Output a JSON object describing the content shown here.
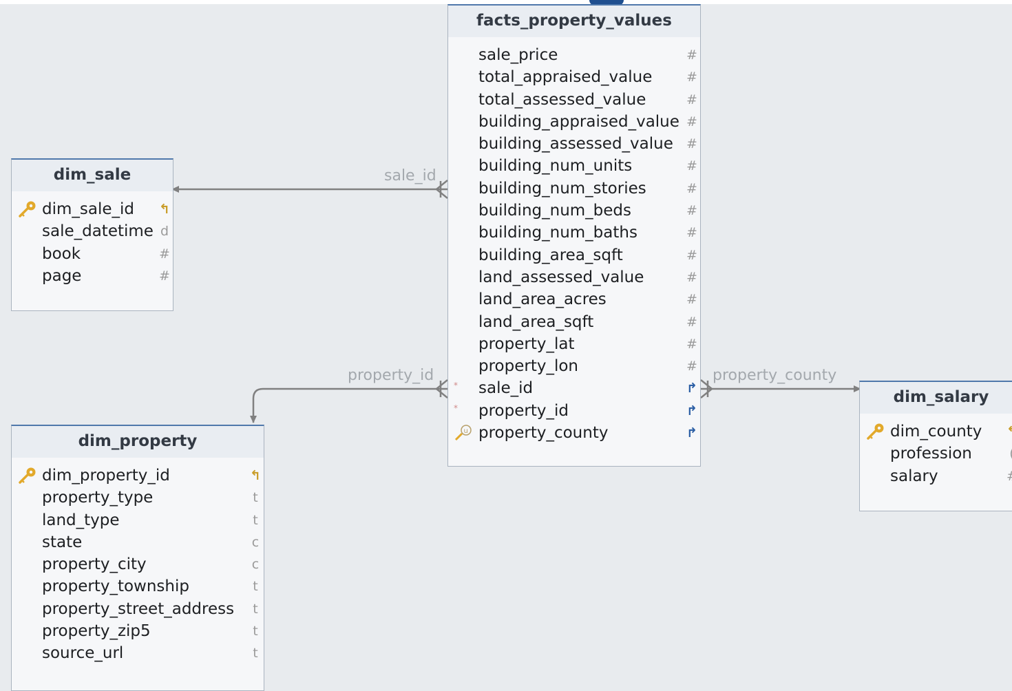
{
  "entities": {
    "facts": {
      "title": "facts_property_values",
      "fields": [
        {
          "name": "sale_price",
          "type": "#"
        },
        {
          "name": "total_appraised_value",
          "type": "#"
        },
        {
          "name": "total_assessed_value",
          "type": "#"
        },
        {
          "name": "building_appraised_value",
          "type": "#"
        },
        {
          "name": "building_assessed_value",
          "type": "#"
        },
        {
          "name": "building_num_units",
          "type": "#"
        },
        {
          "name": "building_num_stories",
          "type": "#"
        },
        {
          "name": "building_num_beds",
          "type": "#"
        },
        {
          "name": "building_num_baths",
          "type": "#"
        },
        {
          "name": "building_area_sqft",
          "type": "#"
        },
        {
          "name": "land_assessed_value",
          "type": "#"
        },
        {
          "name": "land_area_acres",
          "type": "#"
        },
        {
          "name": "land_area_sqft",
          "type": "#"
        },
        {
          "name": "property_lat",
          "type": "#"
        },
        {
          "name": "property_lon",
          "type": "#"
        },
        {
          "name": "sale_id",
          "type": "↱"
        },
        {
          "name": "property_id",
          "type": "↱"
        },
        {
          "name": "property_county",
          "type": "↱"
        }
      ]
    },
    "dim_sale": {
      "title": "dim_sale",
      "fields": [
        {
          "name": "dim_sale_id",
          "type": "↰"
        },
        {
          "name": "sale_datetime",
          "type": "d"
        },
        {
          "name": "book",
          "type": "#"
        },
        {
          "name": "page",
          "type": "#"
        }
      ]
    },
    "dim_property": {
      "title": "dim_property",
      "fields": [
        {
          "name": "dim_property_id",
          "type": "↰"
        },
        {
          "name": "property_type",
          "type": "t"
        },
        {
          "name": "land_type",
          "type": "t"
        },
        {
          "name": "state",
          "type": "c"
        },
        {
          "name": "property_city",
          "type": "c"
        },
        {
          "name": "property_township",
          "type": "t"
        },
        {
          "name": "property_street_address",
          "type": "t"
        },
        {
          "name": "property_zip5",
          "type": "t"
        },
        {
          "name": "source_url",
          "type": "t"
        }
      ]
    },
    "dim_salary": {
      "title": "dim_salary",
      "fields": [
        {
          "name": "dim_county",
          "type": "↰"
        },
        {
          "name": "profession",
          "type": "("
        },
        {
          "name": "salary",
          "type": "#"
        }
      ]
    }
  },
  "relationships": {
    "sale": {
      "label": "sale_id"
    },
    "property": {
      "label": "property_id"
    },
    "county": {
      "label": "property_county"
    }
  },
  "colors": {
    "background": "#e8ebee",
    "connector": "#808080",
    "header_border": "#4f78ab",
    "key_icon": "#e2a92b",
    "fk_arrow": "#2c5fa5"
  },
  "icons": {
    "primary_key": "key-icon",
    "foreign_key": "fk-arrow-icon",
    "unique_key": "unique-key-icon",
    "not_null": "not-null-mark-icon"
  }
}
